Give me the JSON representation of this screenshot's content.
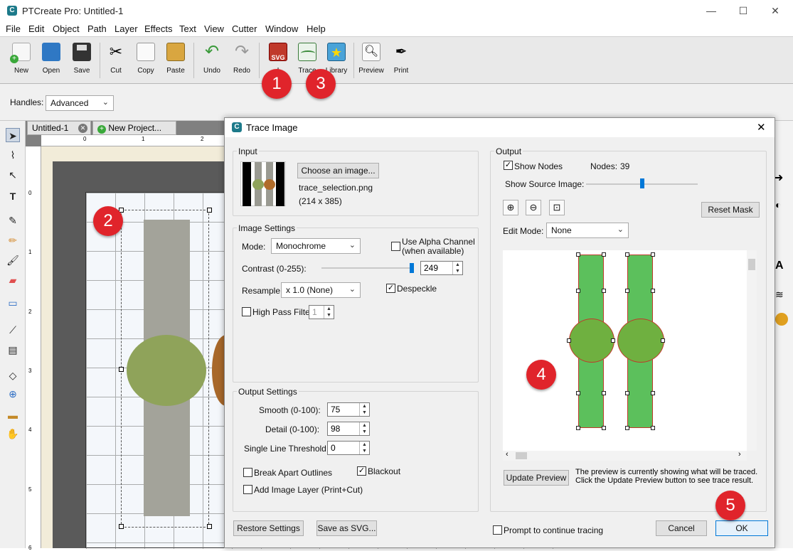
{
  "app": {
    "title": "PTCreate Pro: Untitled-1",
    "icon_letter": "C"
  },
  "window_controls": {
    "minimize": "—",
    "maximize": "☐",
    "close": "✕"
  },
  "menu": [
    "File",
    "Edit",
    "Object",
    "Path",
    "Layer",
    "Effects",
    "Text",
    "View",
    "Cutter",
    "Window",
    "Help"
  ],
  "toolbar": {
    "new": "New",
    "open": "Open",
    "save": "Save",
    "cut": "Cut",
    "copy": "Copy",
    "paste": "Paste",
    "undo": "Undo",
    "redo": "Redo",
    "import": "I",
    "trace": "Trace",
    "library": "Library",
    "preview": "Preview",
    "print": "Print",
    "svg_label": "SVG"
  },
  "handles": {
    "label": "Handles:",
    "value": "Advanced"
  },
  "doc_tabs": {
    "tab1": "Untitled-1",
    "tab2": "New Project..."
  },
  "ruler": {
    "top": [
      "0",
      "1",
      "2"
    ],
    "left": [
      "0",
      "1",
      "2",
      "3",
      "4",
      "5",
      "6"
    ],
    "inner_top": [
      "1",
      "2"
    ]
  },
  "badges": {
    "b1": "1",
    "b2": "2",
    "b3": "3",
    "b4": "4",
    "b5": "5"
  },
  "dialog": {
    "title": "Trace Image",
    "close": "✕",
    "input": {
      "group": "Input",
      "choose_button": "Choose an image...",
      "filename": "trace_selection.png",
      "dimensions": "(214 x 385)"
    },
    "image_settings": {
      "group": "Image Settings",
      "mode_label": "Mode:",
      "mode_value": "Monochrome",
      "alpha_label_1": "Use Alpha Channel",
      "alpha_label_2": "(when available)",
      "alpha_checked": false,
      "contrast_label": "Contrast (0-255):",
      "contrast_value": "249",
      "contrast_fraction": 0.976,
      "resample_label": "Resample:",
      "resample_value": "x 1.0 (None)",
      "despeckle_label": "Despeckle",
      "despeckle_checked": true,
      "highpass_label": "High Pass Filter",
      "highpass_checked": false,
      "highpass_value": "1"
    },
    "output_settings": {
      "group": "Output Settings",
      "smooth_label": "Smooth (0-100):",
      "smooth_value": "75",
      "detail_label": "Detail (0-100):",
      "detail_value": "98",
      "slt_label": "Single Line Threshold:",
      "slt_value": "0",
      "break_label": "Break Apart Outlines",
      "break_checked": false,
      "blackout_label": "Blackout",
      "blackout_checked": true,
      "addlayer_label": "Add Image Layer (Print+Cut)",
      "addlayer_checked": false
    },
    "output": {
      "group": "Output",
      "show_nodes_label": "Show Nodes",
      "show_nodes_checked": true,
      "nodes_label": "Nodes:",
      "nodes_value": "39",
      "show_source_label": "Show Source Image:",
      "source_fraction": 0.5,
      "reset_mask": "Reset Mask",
      "edit_mode_label": "Edit Mode:",
      "edit_mode_value": "None",
      "update_preview": "Update Preview",
      "preview_note": "The preview is currently showing what will be traced. Click the Update Preview button to see trace result."
    },
    "footer": {
      "restore": "Restore Settings",
      "save_svg": "Save as SVG...",
      "prompt_label": "Prompt to continue tracing",
      "prompt_checked": false,
      "cancel": "Cancel",
      "ok": "OK"
    }
  },
  "colors": {
    "accent": "#0078d7",
    "badge": "#e0242b",
    "trace_green": "#5cc05c",
    "medallion": "#8fa35a",
    "strap": "#a3a39a"
  }
}
